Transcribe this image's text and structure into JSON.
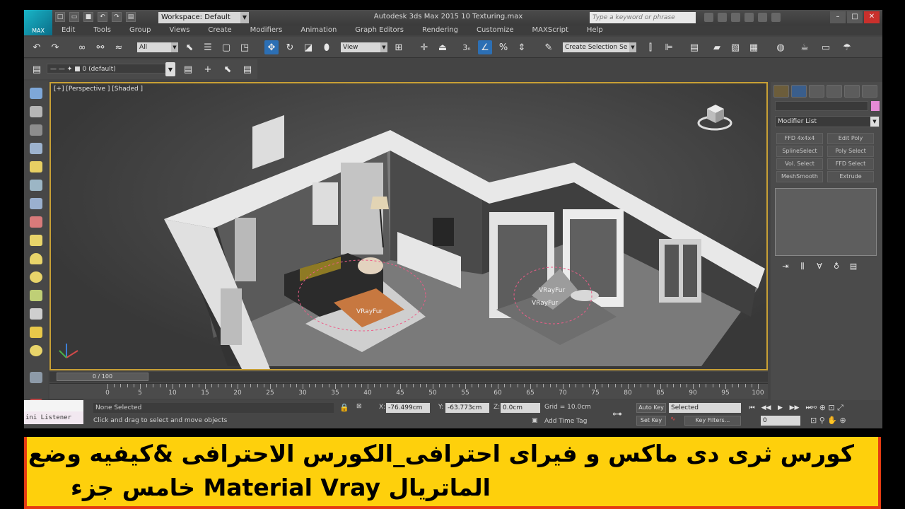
{
  "app": {
    "logo_text": "MAX",
    "workspace": "Workspace: Default",
    "window_title": "Autodesk 3ds Max  2015     10 Texturing.max",
    "search_placeholder": "Type a keyword or phrase"
  },
  "menu": [
    "Edit",
    "Tools",
    "Group",
    "Views",
    "Create",
    "Modifiers",
    "Animation",
    "Graph Editors",
    "Rendering",
    "Customize",
    "MAXScript",
    "Help"
  ],
  "toolbar": {
    "filter": "All",
    "coord": "View",
    "selection_set": "Create Selection Se",
    "snap_label": "3",
    "layer": "0 (default)"
  },
  "viewport": {
    "label": "[+] [Perspective ] [Shaded ]",
    "objects": [
      "VRayFur",
      "VRayFur",
      "VRayFur"
    ],
    "accent_color": "#c8a035"
  },
  "command_panel": {
    "modifier_list": "Modifier List",
    "modifiers": [
      "FFD 4x4x4",
      "Edit Poly",
      "SplineSelect",
      "Poly Select",
      "Vol. Select",
      "FFD Select",
      "MeshSmooth",
      "Extrude"
    ]
  },
  "timeline": {
    "slider": "0 / 100",
    "ticks": [
      "0",
      "5",
      "10",
      "15",
      "20",
      "25",
      "30",
      "35",
      "40",
      "45",
      "50",
      "55",
      "60",
      "65",
      "70",
      "75",
      "80",
      "85",
      "90",
      "95",
      "100"
    ]
  },
  "status": {
    "mini_listener": "ini Listener",
    "selection": "None Selected",
    "prompt": "Click and drag to select and move objects",
    "x_label": "X:",
    "x_value": "-76.499cm",
    "y_label": "Y:",
    "y_value": "-63.773cm",
    "z_label": "Z:",
    "z_value": "0.0cm",
    "grid": "Grid = 10.0cm",
    "add_time_tag": "Add Time Tag",
    "auto_key": "Auto Key",
    "auto_key_mode": "Selected",
    "set_key": "Set Key",
    "key_filters": "Key Filters...",
    "frame": "0"
  },
  "banner": {
    "line1": "کورس ثری دی ماکس و فیرای احترافی_الکورس الاحترافی &کیفیه وضع",
    "line2": "الماتریال Material Vray  خامس جزء",
    "bg_color": "#fed00c",
    "border_color": "#e43c12"
  }
}
